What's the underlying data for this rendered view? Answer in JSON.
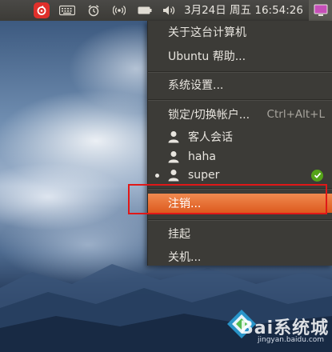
{
  "panel": {
    "clock": "3月24日 周五 16:54:26",
    "icons": [
      "netease-music-icon",
      "keyboard-icon",
      "alarm-clock-icon",
      "wireless-icon",
      "battery-icon",
      "volume-icon",
      "session-icon"
    ]
  },
  "menu": {
    "about": "关于这台计算机",
    "help": "Ubuntu 帮助...",
    "settings": "系统设置...",
    "lock": "锁定/切换帐户...",
    "lock_accel": "Ctrl+Alt+L",
    "users": [
      "客人会话",
      "haha",
      "super"
    ],
    "active_user_index": 2,
    "logout": "注销...",
    "suspend": "挂起",
    "shutdown": "关机..."
  },
  "watermark": {
    "text": "Bai系统城",
    "url": "jingyan.baidu.com"
  },
  "colors": {
    "panel": "#3c3b37",
    "highlight": "#dd5a1e",
    "annotation": "#e01818",
    "active_check": "#55a318"
  }
}
